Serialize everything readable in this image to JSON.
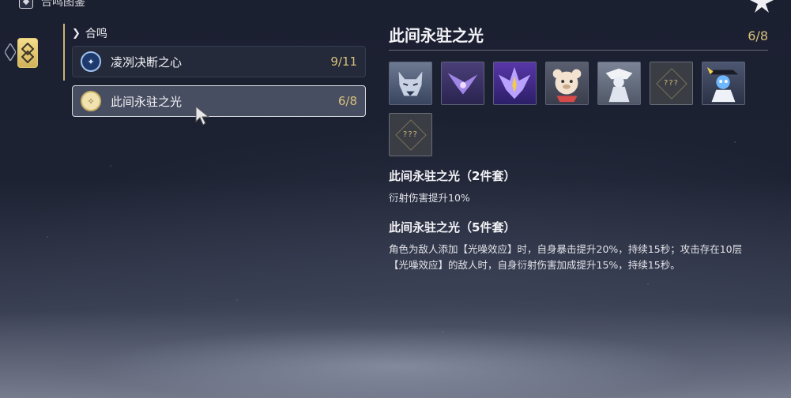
{
  "window": {
    "title": "合鸣图鉴"
  },
  "category": {
    "label": "合鸣"
  },
  "sets": [
    {
      "name": "凌冽决断之心",
      "count": "9/11",
      "icon": "snowflake-icon",
      "selected": false
    },
    {
      "name": "此间永驻之光",
      "count": "6/8",
      "icon": "light-sigil-icon",
      "selected": true
    }
  ],
  "detail": {
    "title": "此间永驻之光",
    "count": "6/8",
    "echoes": [
      {
        "icon": "wolf-echo-icon",
        "unknown": false
      },
      {
        "icon": "purple-bird-echo-icon",
        "unknown": false
      },
      {
        "icon": "violet-wing-echo-icon",
        "unknown": false
      },
      {
        "icon": "bear-echo-icon",
        "unknown": false
      },
      {
        "icon": "white-robe-echo-icon",
        "unknown": false
      },
      {
        "icon": "unknown-echo-icon",
        "unknown": true,
        "label": "???"
      },
      {
        "icon": "hat-figure-echo-icon",
        "unknown": false
      },
      {
        "icon": "unknown-echo-icon",
        "unknown": true,
        "label": "???"
      }
    ],
    "bonuses": [
      {
        "title": "此间永驻之光（2件套）",
        "desc": "衍射伤害提升10%"
      },
      {
        "title": "此间永驻之光（5件套）",
        "desc": "角色为敌人添加【光噪效应】时，自身暴击提升20%，持续15秒；攻击存在10层【光噪效应】的敌人时，自身衍射伤害加成提升15%，持续15秒。"
      }
    ]
  },
  "colors": {
    "gold": "#d8c07c",
    "tab_gold": "#f4dd8c"
  }
}
